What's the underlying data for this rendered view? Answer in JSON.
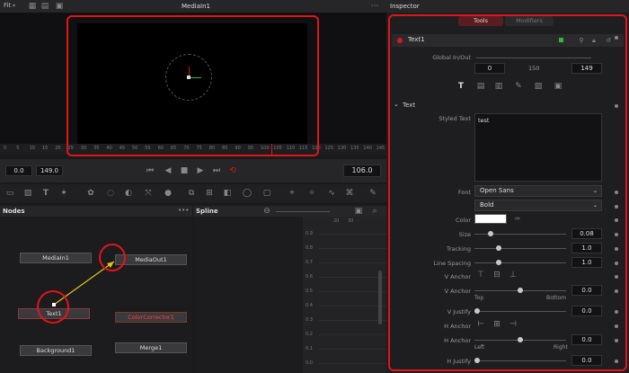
{
  "viewer": {
    "fit_label": "Fit",
    "title": "MediaIn1",
    "time_start": "0.0",
    "time_end": "149.0",
    "current_time": "106.0",
    "ruler_ticks": [
      "0",
      "5",
      "10",
      "15",
      "20",
      "25",
      "30",
      "35",
      "40",
      "45",
      "50",
      "55",
      "60",
      "65",
      "70",
      "75",
      "80",
      "85",
      "90",
      "95",
      "100",
      "105",
      "110",
      "115",
      "120",
      "125",
      "130",
      "135",
      "140",
      "145"
    ]
  },
  "nodes_panel": {
    "title": "Nodes",
    "menu": "•••",
    "nodes": [
      "MediaIn1",
      "MediaOut1",
      "Text1",
      "ColorCorrector1",
      "Background1",
      "Merge1"
    ]
  },
  "spline_panel": {
    "title": "Spline",
    "menu": "•••",
    "col_ticks": [
      "20",
      "30"
    ],
    "row_ticks": [
      "0.9",
      "0.8",
      "0.7",
      "0.6",
      "0.5",
      "0.4",
      "0.3",
      "0.2",
      "0.1",
      "0.0"
    ]
  },
  "inspector": {
    "title": "Inspector",
    "tabs": [
      "Tools",
      "Modifiers"
    ],
    "tool_name": "Text1",
    "global_inout_label": "Global In/Out",
    "global_in": "0",
    "global_mid": "150",
    "global_out": "149",
    "section_title": "Text",
    "styled_text_label": "Styled Text",
    "styled_text_value": "test",
    "font_label": "Font",
    "font_value": "Open Sans",
    "font_style": "Bold",
    "color_label": "Color",
    "color_value": "#ffffff",
    "size_label": "Size",
    "size_value": "0.08",
    "tracking_label": "Tracking",
    "tracking_value": "1.0",
    "line_spacing_label": "Line Spacing",
    "line_spacing_value": "1.0",
    "v_anchor_label": "V Anchor",
    "v_anchor2_label": "V Anchor",
    "v_anchor2_value": "0.0",
    "top_label": "Top",
    "bottom_label": "Bottom",
    "v_justify_label": "V Justify",
    "v_justify_value": "0.0",
    "h_anchor_label": "H Anchor",
    "h_anchor2_label": "H Anchor",
    "h_anchor2_value": "0.0",
    "left_label": "Left",
    "right_label": "Right",
    "h_justify_label": "H Justify",
    "h_justify_value": "0.0"
  },
  "colors": {
    "accent_red": "#e0151a",
    "tab_active": "#5a1d22",
    "text_red": "#ff4040",
    "green": "#3cb043"
  }
}
